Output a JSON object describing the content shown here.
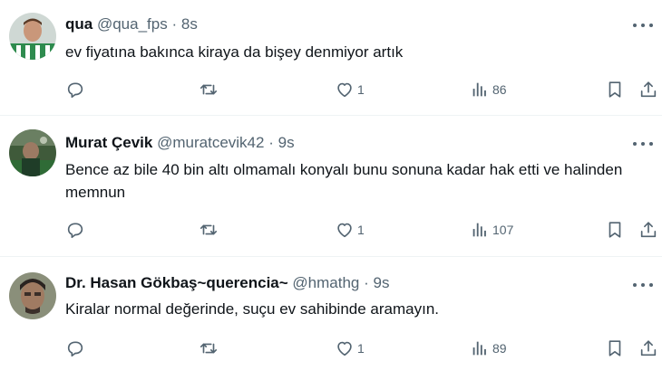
{
  "tweets": [
    {
      "name": "qua",
      "handle": "@qua_fps",
      "dot": "·",
      "time": "8s",
      "text": "ev fiyatına bakınca kiraya da bişey denmiyor artık",
      "likes": "1",
      "views": "86"
    },
    {
      "name": "Murat Çevik",
      "handle": "@muratcevik42",
      "dot": "·",
      "time": "9s",
      "text": "Bence az bile 40 bin altı olmamalı konyalı bunu sonuna kadar hak etti ve halinden memnun",
      "likes": "1",
      "views": "107"
    },
    {
      "name": "Dr. Hasan Gökbaş~querencia~",
      "handle": "@hmathg",
      "dot": "·",
      "time": "9s",
      "text": "Kiralar normal değerinde, suçu ev sahibinde aramayın.",
      "likes": "1",
      "views": "89"
    }
  ],
  "icons": {
    "reply": "reply-icon",
    "retweet": "retweet-icon",
    "like": "heart-icon",
    "views": "views-icon",
    "bookmark": "bookmark-icon",
    "share": "share-icon",
    "more": "more-icon"
  },
  "colors": {
    "text": "#0f1419",
    "secondary": "#536471",
    "divider": "#eff3f4"
  }
}
